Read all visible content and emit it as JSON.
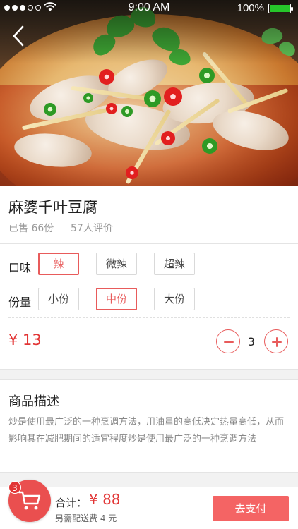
{
  "status_bar": {
    "time": "9:00 AM",
    "battery_percent": "100%",
    "signal_dots_filled": 3,
    "signal_dots_total": 5
  },
  "dish": {
    "name": "麻婆千叶豆腐",
    "sold": "已售 66份",
    "reviews": "57人评价"
  },
  "options": {
    "taste_label": "口味",
    "taste_choices": [
      "辣",
      "微辣",
      "超辣"
    ],
    "taste_selected": "辣",
    "portion_label": "份量",
    "portion_choices": [
      "小份",
      "中份",
      "大份"
    ],
    "portion_selected": "中份"
  },
  "price": "¥ 13",
  "quantity": "3",
  "description": {
    "title": "商品描述",
    "body": "炒是使用最广泛的一种烹调方法，用油量的高低决定热量高低，从而影响其在减肥期间的适宜程度炒是使用最广泛的一种烹调方法"
  },
  "cart": {
    "badge": "3",
    "total_label": "合计：",
    "total_value": "¥ 88",
    "delivery_note": "另需配送费 4 元",
    "pay_button": "去支付"
  },
  "icons": [
    "back-arrow-icon",
    "wifi-icon",
    "battery-icon",
    "minus-icon",
    "plus-icon",
    "cart-icon"
  ],
  "colors": {
    "accent": "#e85b5b",
    "price": "#e23535",
    "pay_button": "#f46464",
    "battery_fill": "#26c52a"
  }
}
